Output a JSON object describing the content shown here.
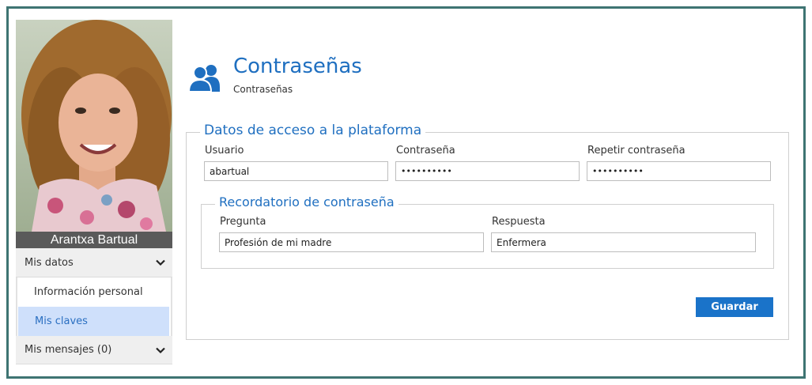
{
  "user": {
    "name": "Arantxa Bartual"
  },
  "sidebar": {
    "section1": {
      "label": "Mis datos",
      "icon": "chevron-down-icon"
    },
    "items": [
      {
        "label": "Información personal"
      },
      {
        "label": "Mis claves"
      }
    ],
    "section2": {
      "label": "Mis mensajes (0)",
      "icon": "chevron-down-icon"
    }
  },
  "header": {
    "icon": "users-icon",
    "title": "Contraseñas",
    "breadcrumb": "Contraseñas"
  },
  "access": {
    "legend": "Datos de acceso a la plataforma",
    "user_label": "Usuario",
    "user_value": "abartual",
    "password_label": "Contraseña",
    "password_value": "••••••••••",
    "repeat_label": "Repetir contraseña",
    "repeat_value": "••••••••••"
  },
  "reminder": {
    "legend": "Recordatorio de contraseña",
    "question_label": "Pregunta",
    "question_value": "Profesión de mi madre",
    "answer_label": "Respuesta",
    "answer_value": "Enfermera"
  },
  "actions": {
    "save_label": "Guardar"
  },
  "colors": {
    "accent": "#1f6fc0",
    "button": "#1a73c9",
    "frame": "#3e7472",
    "active_item": "#cfe0fb"
  }
}
